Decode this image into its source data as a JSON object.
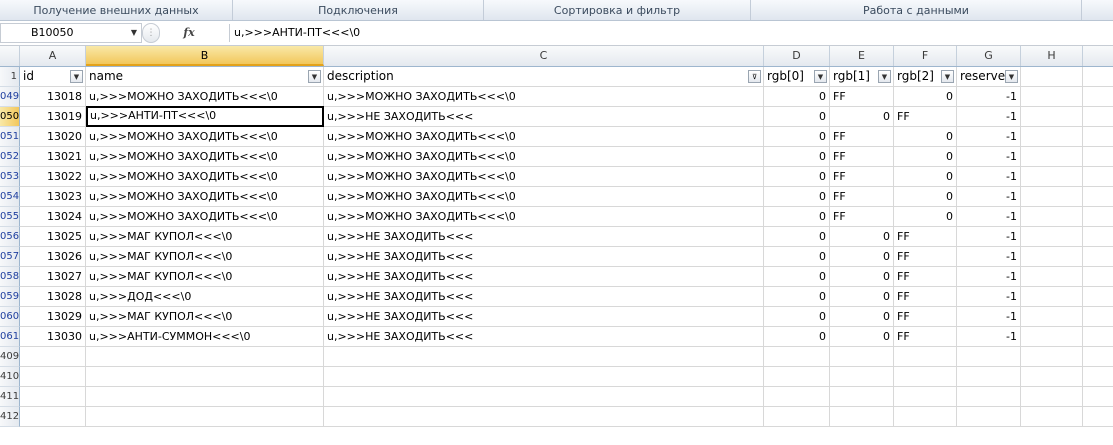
{
  "ribbon": {
    "groups": [
      "Получение внешних данных",
      "Подключения",
      "Сортировка и фильтр",
      "Работа с данными"
    ]
  },
  "formula_bar": {
    "name_box": "B10050",
    "fx": "fx",
    "formula": "u,>>>АНТИ-ПТ<<<\\0"
  },
  "columns": [
    "A",
    "B",
    "C",
    "D",
    "E",
    "F",
    "G",
    "H"
  ],
  "selected_column": "B",
  "header_row": {
    "row_label": "1",
    "fields": [
      "id",
      "name",
      "description",
      "rgb[0]",
      "rgb[1]",
      "rgb[2]",
      "reserve"
    ],
    "filter_icons": [
      "filter-dropdown-icon",
      "filter-dropdown-icon",
      "filter-active-icon",
      "filter-dropdown-icon",
      "filter-dropdown-icon",
      "filter-dropdown-icon",
      "filter-dropdown-icon"
    ]
  },
  "rows": [
    {
      "row_label": "049",
      "id": "13018",
      "name": "u,>>>МОЖНО ЗАХОДИТЬ<<<\\0",
      "description": "u,>>>МОЖНО ЗАХОДИТЬ<<<\\0",
      "rgb0": "0",
      "rgb1": "FF",
      "rgb2": "0",
      "reserve": "-1"
    },
    {
      "row_label": "050",
      "id": "13019",
      "name": "u,>>>АНТИ-ПТ<<<\\0",
      "description": "u,>>>НЕ ЗАХОДИТЬ<<<",
      "rgb0": "0",
      "rgb1": "0",
      "rgb2": "FF",
      "reserve": "-1"
    },
    {
      "row_label": "051",
      "id": "13020",
      "name": "u,>>>МОЖНО ЗАХОДИТЬ<<<\\0",
      "description": "u,>>>МОЖНО ЗАХОДИТЬ<<<\\0",
      "rgb0": "0",
      "rgb1": "FF",
      "rgb2": "0",
      "reserve": "-1"
    },
    {
      "row_label": "052",
      "id": "13021",
      "name": "u,>>>МОЖНО ЗАХОДИТЬ<<<\\0",
      "description": "u,>>>МОЖНО ЗАХОДИТЬ<<<\\0",
      "rgb0": "0",
      "rgb1": "FF",
      "rgb2": "0",
      "reserve": "-1"
    },
    {
      "row_label": "053",
      "id": "13022",
      "name": "u,>>>МОЖНО ЗАХОДИТЬ<<<\\0",
      "description": "u,>>>МОЖНО ЗАХОДИТЬ<<<\\0",
      "rgb0": "0",
      "rgb1": "FF",
      "rgb2": "0",
      "reserve": "-1"
    },
    {
      "row_label": "054",
      "id": "13023",
      "name": "u,>>>МОЖНО ЗАХОДИТЬ<<<\\0",
      "description": "u,>>>МОЖНО ЗАХОДИТЬ<<<\\0",
      "rgb0": "0",
      "rgb1": "FF",
      "rgb2": "0",
      "reserve": "-1"
    },
    {
      "row_label": "055",
      "id": "13024",
      "name": "u,>>>МОЖНО ЗАХОДИТЬ<<<\\0",
      "description": "u,>>>МОЖНО ЗАХОДИТЬ<<<\\0",
      "rgb0": "0",
      "rgb1": "FF",
      "rgb2": "0",
      "reserve": "-1"
    },
    {
      "row_label": "056",
      "id": "13025",
      "name": "u,>>>МАГ КУПОЛ<<<\\0",
      "description": "u,>>>НЕ ЗАХОДИТЬ<<<",
      "rgb0": "0",
      "rgb1": "0",
      "rgb2": "FF",
      "reserve": "-1"
    },
    {
      "row_label": "057",
      "id": "13026",
      "name": "u,>>>МАГ КУПОЛ<<<\\0",
      "description": "u,>>>НЕ ЗАХОДИТЬ<<<",
      "rgb0": "0",
      "rgb1": "0",
      "rgb2": "FF",
      "reserve": "-1"
    },
    {
      "row_label": "058",
      "id": "13027",
      "name": "u,>>>МАГ КУПОЛ<<<\\0",
      "description": "u,>>>НЕ ЗАХОДИТЬ<<<",
      "rgb0": "0",
      "rgb1": "0",
      "rgb2": "FF",
      "reserve": "-1"
    },
    {
      "row_label": "059",
      "id": "13028",
      "name": "u,>>>ДОД<<<\\0",
      "description": "u,>>>НЕ ЗАХОДИТЬ<<<",
      "rgb0": "0",
      "rgb1": "0",
      "rgb2": "FF",
      "reserve": "-1"
    },
    {
      "row_label": "060",
      "id": "13029",
      "name": "u,>>>МАГ КУПОЛ<<<\\0",
      "description": "u,>>>НЕ ЗАХОДИТЬ<<<",
      "rgb0": "0",
      "rgb1": "0",
      "rgb2": "FF",
      "reserve": "-1"
    },
    {
      "row_label": "061",
      "id": "13030",
      "name": "u,>>>АНТИ-СУММОН<<<\\0",
      "description": "u,>>>НЕ ЗАХОДИТЬ<<<",
      "rgb0": "0",
      "rgb1": "0",
      "rgb2": "FF",
      "reserve": "-1"
    }
  ],
  "empty_rows": [
    "409",
    "410",
    "411",
    "412"
  ],
  "selected_row_label": "050",
  "colors": {
    "selected_header": "#f2c75c",
    "row_number_text": "#1f3f9f",
    "grid_line": "#d8d8d8"
  }
}
